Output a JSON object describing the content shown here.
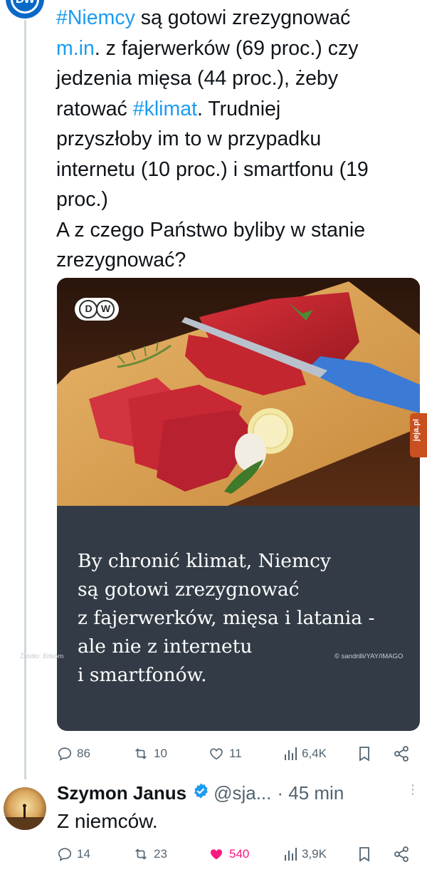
{
  "tweet": {
    "text_lines": [
      [
        {
          "t": "#Niemcy",
          "link": true
        },
        {
          "t": " są gotowi zrezygnować",
          "link": false
        }
      ],
      [
        {
          "t": "m.in",
          "link": true
        },
        {
          "t": ". z fajerwerków (69 proc.) czy",
          "link": false
        }
      ],
      [
        {
          "t": "jedzenia mięsa (44 proc.), żeby",
          "link": false
        }
      ],
      [
        {
          "t": "ratować ",
          "link": false
        },
        {
          "t": "#klimat",
          "link": true
        },
        {
          "t": ". Trudniej",
          "link": false
        }
      ],
      [
        {
          "t": "przyszłoby im to w przypadku",
          "link": false
        }
      ],
      [
        {
          "t": "internetu (10 proc.) i smartfonu (19",
          "link": false
        }
      ],
      [
        {
          "t": "proc.)",
          "link": false
        }
      ],
      [
        {
          "t": "A z czego Państwo byliby w stanie",
          "link": false
        }
      ],
      [
        {
          "t": "zrezygnować?",
          "link": false
        }
      ]
    ],
    "media": {
      "logo": "DW",
      "headline_lines": [
        "By chronić klimat, Niemcy",
        "są gotowi zrezygnować",
        "z fajerwerków, mięsa i latania -",
        "ale nie z internetu",
        "i smartfonów."
      ],
      "source": "Źródło: Bitkom",
      "credit": "© sandrilli/YAY/IMAGO"
    },
    "actions": {
      "replies": "86",
      "retweets": "10",
      "likes": "11",
      "views": "6,4K"
    }
  },
  "reply": {
    "name": "Szymon Janus",
    "handle": "@sja...",
    "time": "· 45 min",
    "text": "Z niemców.",
    "actions": {
      "replies": "14",
      "retweets": "23",
      "likes": "540",
      "views": "3,9K"
    }
  },
  "watermark": "jeja.pl",
  "colors": {
    "link": "#1d9bf0",
    "like_active": "#f91880",
    "muted": "#536471",
    "card_bg": "#333c46",
    "dw_blue": "#0a69c7"
  },
  "icons": [
    "reply-icon",
    "retweet-icon",
    "like-icon",
    "views-icon",
    "bookmark-icon",
    "share-icon",
    "verified-badge-icon",
    "more-icon"
  ]
}
